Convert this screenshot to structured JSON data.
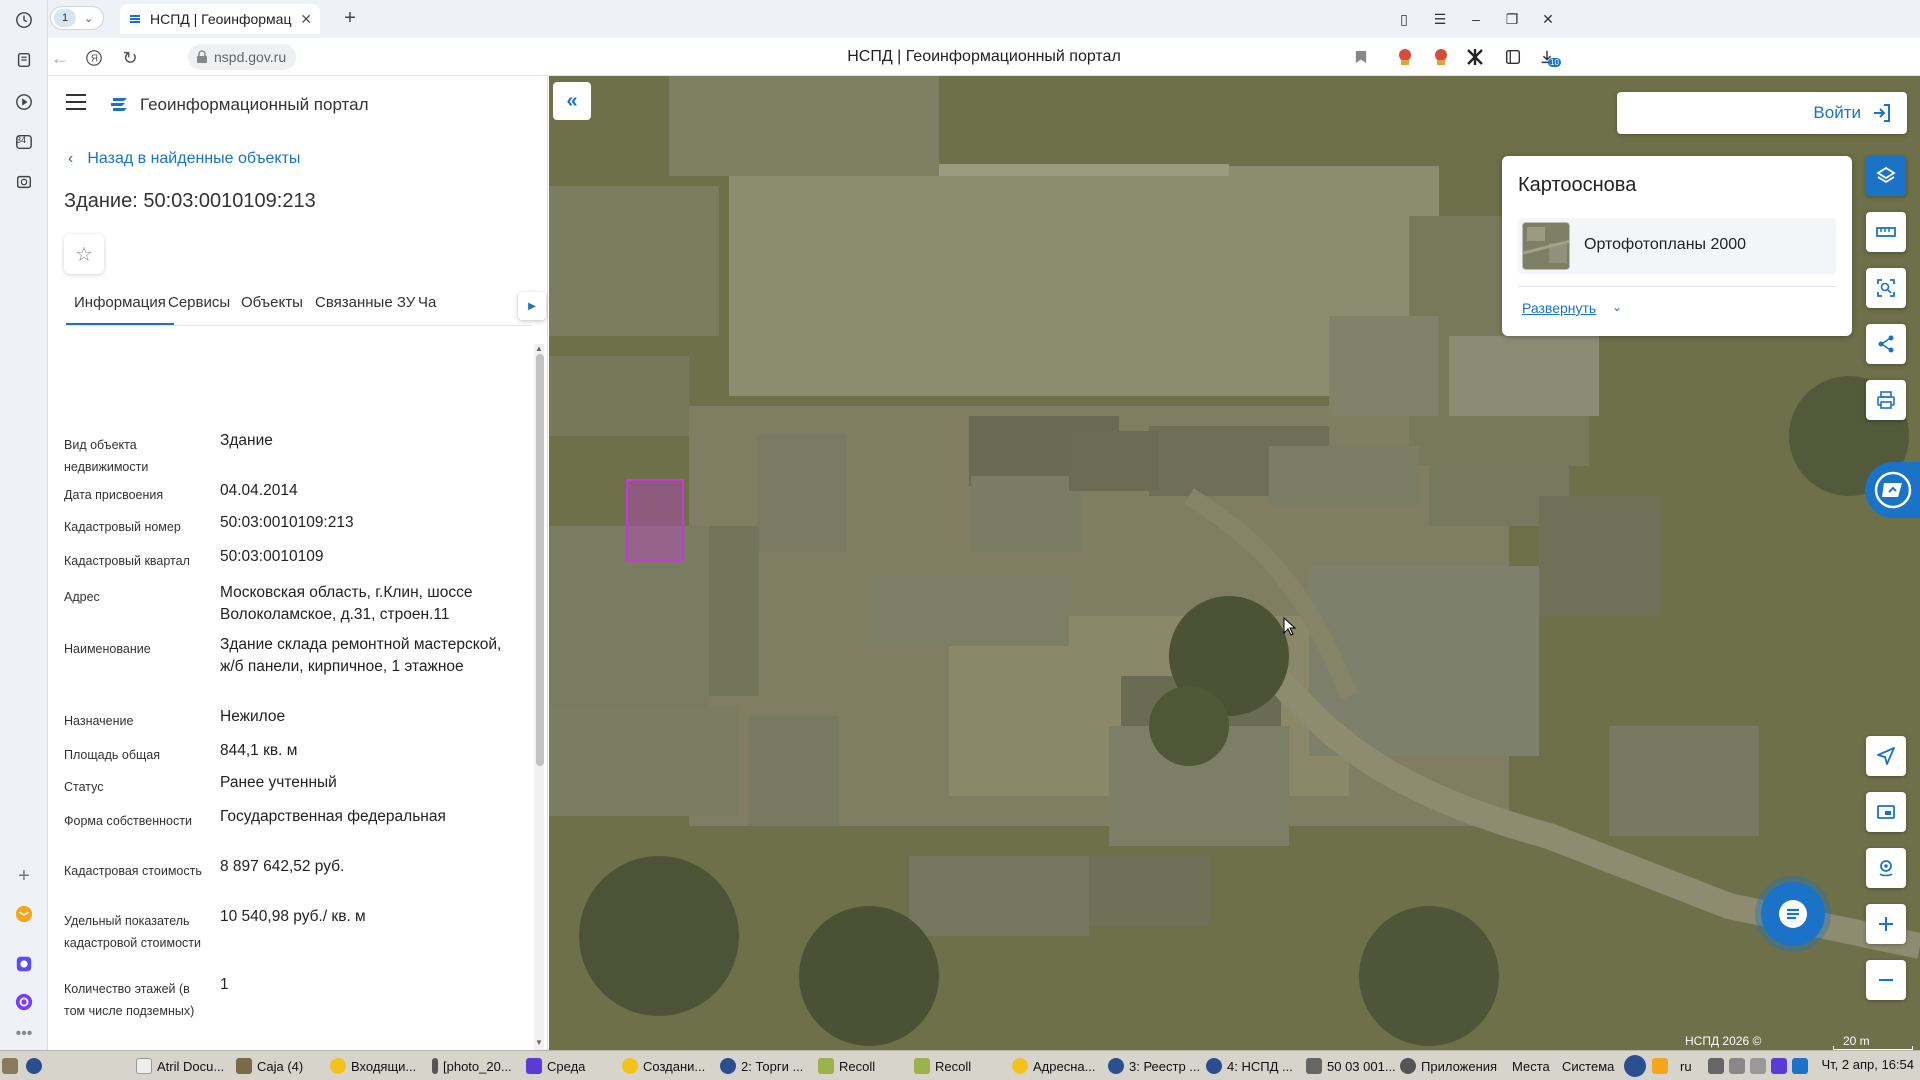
{
  "browser": {
    "tab_count": "1",
    "tab_title": "НСПД | Геоинформаци",
    "url": "nspd.gov.ru",
    "page_title": "НСПД | Геоинформационный портал",
    "sidebar_badge": "34",
    "download_badge": "10"
  },
  "panel": {
    "portal_name": "Геоинформационный портал",
    "back_label": "Назад в найденные объекты",
    "object_title": "Здание: 50:03:0010109:213",
    "tabs": [
      "Информация",
      "Сервисы",
      "Объекты",
      "Связанные ЗУ",
      "Ча"
    ],
    "properties": [
      {
        "label": "Вид объекта недвижимости",
        "value": "Здание"
      },
      {
        "label": "Дата присвоения",
        "value": "04.04.2014"
      },
      {
        "label": "Кадастровый номер",
        "value": "50:03:0010109:213"
      },
      {
        "label": "Кадастровый квартал",
        "value": "50:03:0010109"
      },
      {
        "label": "Адрес",
        "value": "Московская область, г.Клин, шоссе Волоколамское, д.31, строен.11"
      },
      {
        "label": "Наименование",
        "value": "Здание склада ремонтной мастерской, ж/б панели, кирпичное, 1 этажное"
      },
      {
        "label": "Назначение",
        "value": "Нежилое"
      },
      {
        "label": "Площадь общая",
        "value": "844,1 кв. м"
      },
      {
        "label": "Статус",
        "value": "Ранее учтенный"
      },
      {
        "label": "Форма собственности",
        "value": "Государственная федеральная"
      },
      {
        "label": "Кадастровая стоимость",
        "value": "8 897 642,52 руб."
      },
      {
        "label": "Удельный показатель кадастровой стоимости",
        "value": "10 540,98 руб./ кв. м"
      },
      {
        "label": "Количество этажей (в том числе подземных)",
        "value": "1"
      }
    ]
  },
  "map": {
    "login_label": "Войти",
    "basemap_title": "Картооснова",
    "basemap_item": "Ортофотопланы 2000",
    "expand_label": "Развернуть",
    "copyright": "НСПД 2026 ©",
    "scale_label": "20 m",
    "highlight_color": "#c43ad6"
  },
  "taskbar": {
    "items": [
      "Atril Docu...",
      "Caja (4)",
      "Входящи...",
      "[photo_20...",
      "Среда",
      "Создани...",
      "2: Торги ...",
      "Recoll",
      "Recoll",
      "Адресна...",
      "3: Реестр ...",
      "4: НСПД ...",
      "50 03 001..."
    ],
    "menus": [
      "Приложения",
      "Места",
      "Система"
    ],
    "lang": "ru",
    "clock": "Чт, 2 апр, 16:54"
  }
}
